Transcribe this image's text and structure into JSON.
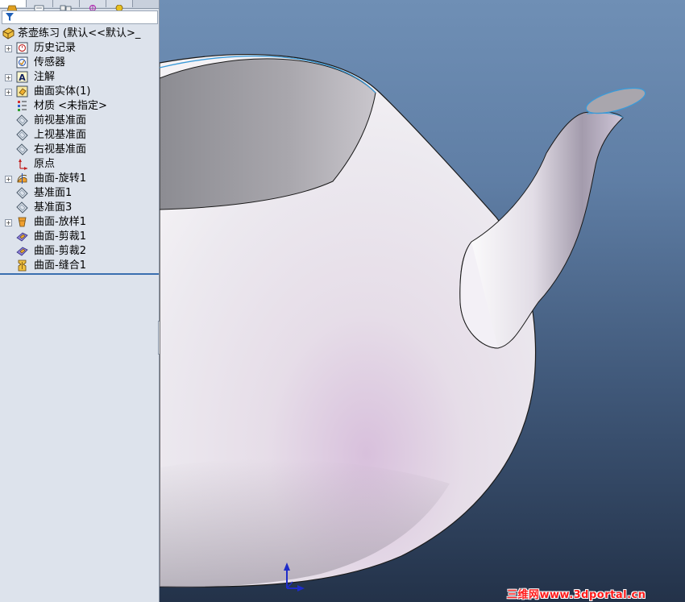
{
  "feature_tree": {
    "root_label": "茶壶练习 (默认<<默认>_",
    "items": [
      {
        "label": "历史记录",
        "icon": "history-icon",
        "expandable": true
      },
      {
        "label": "传感器",
        "icon": "sensor-icon",
        "expandable": false
      },
      {
        "label": "注解",
        "icon": "annotation-icon",
        "expandable": true
      },
      {
        "label": "曲面实体(1)",
        "icon": "surface-bodies-icon",
        "expandable": true
      },
      {
        "label": "材质 <未指定>",
        "icon": "material-icon",
        "expandable": false
      },
      {
        "label": "前视基准面",
        "icon": "plane-icon",
        "expandable": false
      },
      {
        "label": "上视基准面",
        "icon": "plane-icon",
        "expandable": false
      },
      {
        "label": "右视基准面",
        "icon": "plane-icon",
        "expandable": false
      },
      {
        "label": "原点",
        "icon": "origin-icon",
        "expandable": false
      },
      {
        "label": "曲面-旋转1",
        "icon": "surface-revolve-icon",
        "expandable": true
      },
      {
        "label": "基准面1",
        "icon": "plane-icon",
        "expandable": false
      },
      {
        "label": "基准面3",
        "icon": "plane-icon",
        "expandable": false
      },
      {
        "label": "曲面-放样1",
        "icon": "surface-loft-icon",
        "expandable": true
      },
      {
        "label": "曲面-剪裁1",
        "icon": "surface-trim-icon",
        "expandable": false
      },
      {
        "label": "曲面-剪裁2",
        "icon": "surface-trim-icon",
        "expandable": false
      },
      {
        "label": "曲面-缝合1",
        "icon": "surface-knit-icon",
        "expandable": false
      }
    ]
  },
  "watermark": "三维网www.3dportal.cn",
  "colors": {
    "tree_bg": "#dde3ec",
    "accent": "#3a6fb0",
    "watermark": "#ff1a1a"
  }
}
